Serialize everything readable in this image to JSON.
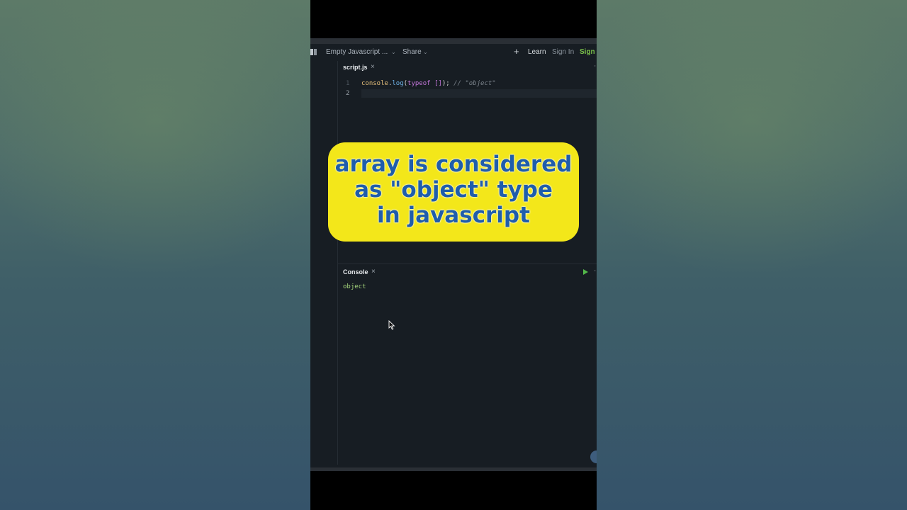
{
  "navbar": {
    "project_name": "Empty Javascript ...",
    "share": "Share",
    "learn": "Learn",
    "sign_in": "Sign In",
    "sign_up": "Sign U",
    "icons": [
      "sidebar-toggle-icon",
      "chevron-down-icon",
      "plus-icon"
    ]
  },
  "editor": {
    "tab_name": "script.js",
    "close_symbol": "×",
    "line_numbers": [
      "1",
      "2"
    ],
    "code": {
      "obj": "console",
      "dot": ".",
      "fn": "log",
      "open": "(",
      "kw": "typeof",
      "space": " ",
      "arr": "[]",
      "close": ");",
      "comment": " // \"object\""
    }
  },
  "overlay": {
    "lines": [
      "array is considered",
      "as \"object\" type",
      "in javascript"
    ]
  },
  "console": {
    "tab_name": "Console",
    "close_symbol": "×",
    "output": "object"
  },
  "colors": {
    "accent_green": "#7bc14a",
    "caption_bg": "#f3e71a",
    "caption_text": "#1f5dab",
    "editor_bg": "#171d23"
  }
}
